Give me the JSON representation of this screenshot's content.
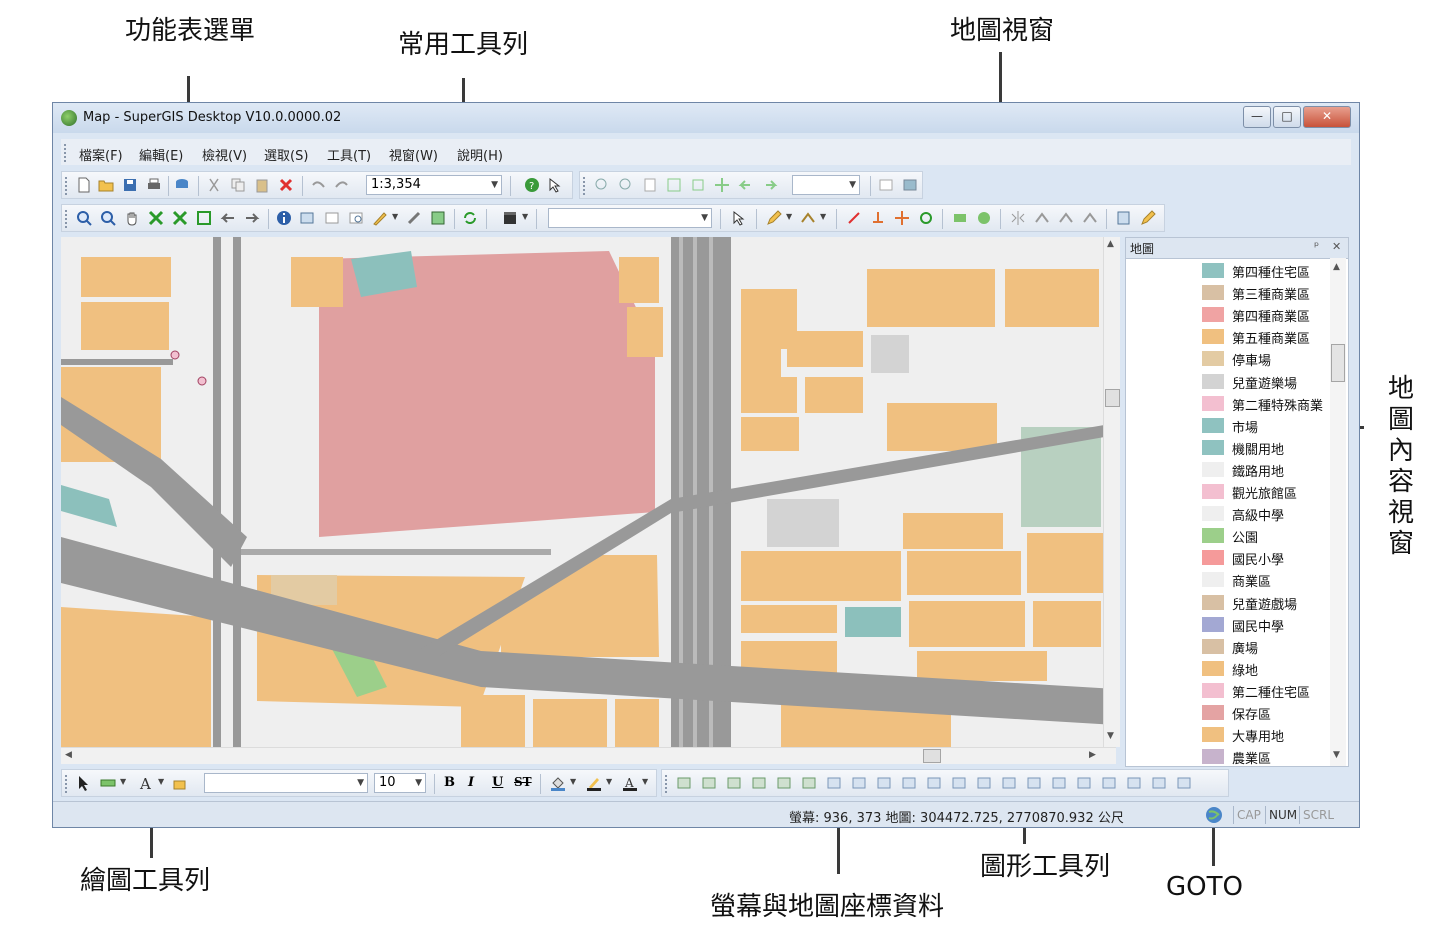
{
  "annotations": {
    "menu": "功能表選單",
    "standard_toolbar": "常用工具列",
    "map_view": "地圖視窗",
    "toc_view": "地圖內容視窗",
    "draw_toolbar": "繪圖工具列",
    "coords": "螢幕與地圖座標資料",
    "graphics_toolbar": "圖形工具列",
    "goto": "GOTO"
  },
  "window": {
    "title": "Map - SuperGIS Desktop V10.0.0000.02",
    "buttons": {
      "minimize": "—",
      "maximize": "□",
      "close": "✕"
    }
  },
  "menubar": [
    "檔案(F)",
    "編輯(E)",
    "檢視(V)",
    "選取(S)",
    "工具(T)",
    "視窗(W)",
    "說明(H)"
  ],
  "standard_toolbar": {
    "scale": "1:3,354"
  },
  "draw_toolbar": {
    "font_size": "10",
    "bold": "B",
    "italic": "I",
    "underline": "U",
    "strike": "ST"
  },
  "toc": {
    "title": "地圖",
    "pin": "ᵖ",
    "close": "✕",
    "items": [
      {
        "label": "第四種住宅區",
        "color": "#8fc2c0"
      },
      {
        "label": "第三種商業區",
        "color": "#d8c0a4"
      },
      {
        "label": "第四種商業區",
        "color": "#f0a3a3"
      },
      {
        "label": "第五種商業區",
        "color": "#f0c080"
      },
      {
        "label": "停車場",
        "color": "#e3cba3"
      },
      {
        "label": "兒童遊樂場",
        "color": "#d3d3d3"
      },
      {
        "label": "第二種特殊商業",
        "color": "#f3bfd0"
      },
      {
        "label": "市場",
        "color": "#8fc2c0"
      },
      {
        "label": "機關用地",
        "color": "#8fc2c0"
      },
      {
        "label": "鐵路用地",
        "color": "#efefef"
      },
      {
        "label": "觀光旅館區",
        "color": "#f3bfd0"
      },
      {
        "label": "高級中學",
        "color": "#efefef"
      },
      {
        "label": "公園",
        "color": "#9ccf8a"
      },
      {
        "label": "國民小學",
        "color": "#f59a9a"
      },
      {
        "label": "商業區",
        "color": "#efefef"
      },
      {
        "label": "兒童遊戲場",
        "color": "#d8c0a4"
      },
      {
        "label": "國民中學",
        "color": "#a3a8d3"
      },
      {
        "label": "廣場",
        "color": "#d8c0a4"
      },
      {
        "label": "綠地",
        "color": "#f0c080"
      },
      {
        "label": "第二種住宅區",
        "color": "#f3bfd0"
      },
      {
        "label": "保存區",
        "color": "#e4a3a3"
      },
      {
        "label": "大專用地",
        "color": "#f0c080"
      },
      {
        "label": "農業區",
        "color": "#c7b3cc"
      }
    ]
  },
  "statusbar": {
    "coords": "螢幕: 936, 373  地圖: 304472.725, 2770870.932 公尺",
    "cap": "CAP",
    "num": "NUM",
    "scrl": "SCRL"
  }
}
